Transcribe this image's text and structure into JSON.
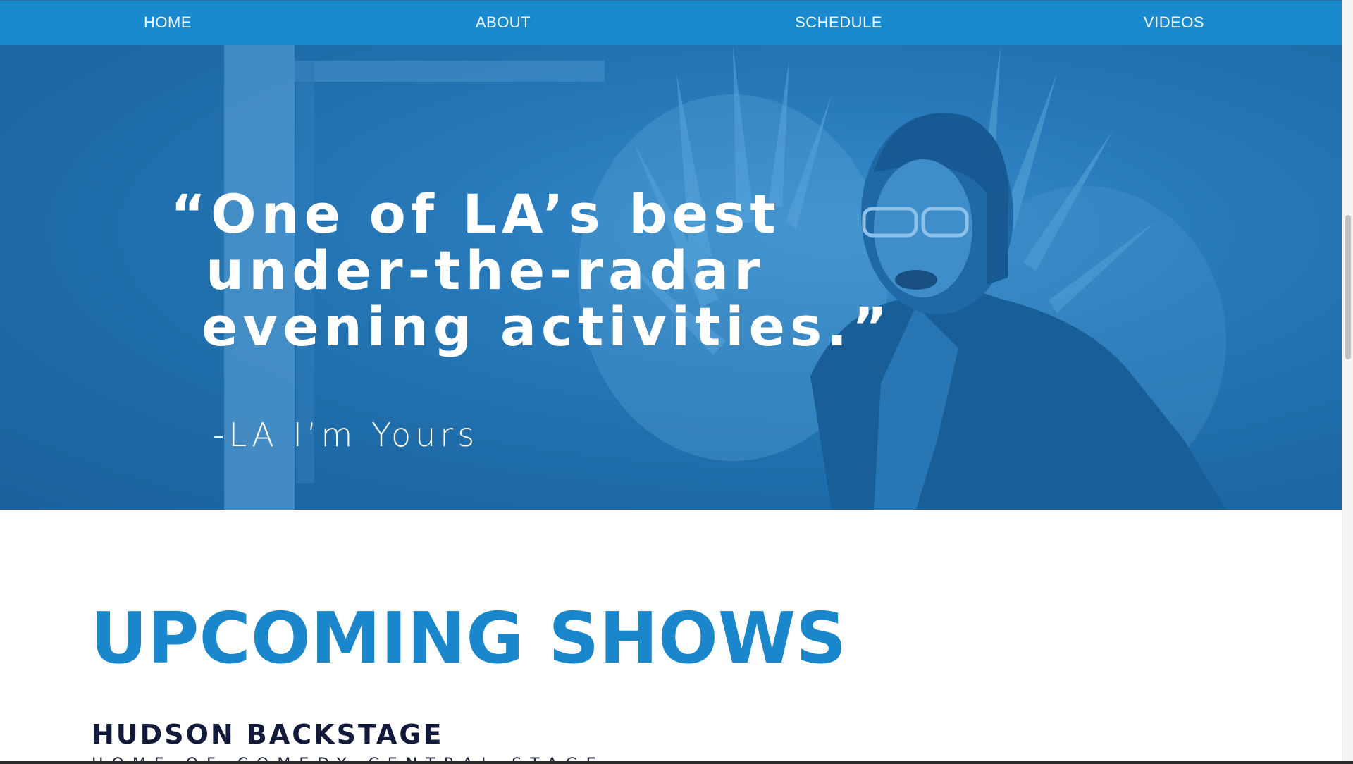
{
  "nav": {
    "items": [
      {
        "label": "HOME"
      },
      {
        "label": "ABOUT"
      },
      {
        "label": "SCHEDULE"
      },
      {
        "label": "VIDEOS"
      }
    ]
  },
  "hero": {
    "quote_lines": [
      "“One of LA’s best",
      "under-the-radar",
      "evening activities.”"
    ],
    "attribution": "-LA I’m Yours",
    "overlay_color": "#1a7fc4"
  },
  "shows": {
    "title": "UPCOMING SHOWS",
    "venue": {
      "name": "HUDSON BACKSTAGE",
      "subtitle": "HOME OF COMEDY CENTRAL STAGE"
    }
  },
  "colors": {
    "nav_bg": "#1a8acf",
    "accent": "#1a86cc",
    "dark_text": "#111a3a"
  }
}
